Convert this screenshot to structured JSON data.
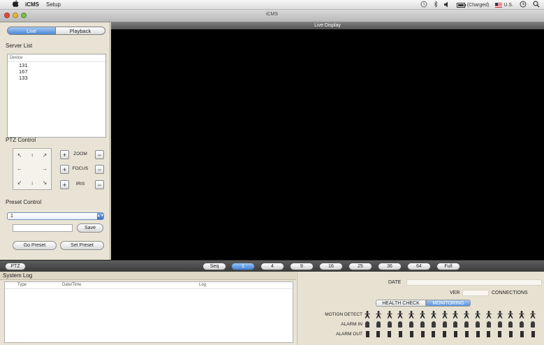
{
  "menubar": {
    "app_name": "iCMS",
    "menus": [
      "Setup"
    ],
    "status_items": {
      "battery_text": "(Charged)",
      "input_source": "U.S."
    }
  },
  "window": {
    "title": "iCMS"
  },
  "mode_tabs": {
    "live": "Live",
    "playback": "Playback",
    "selected": "Live"
  },
  "server_list": {
    "title": "Server List",
    "column": "Device",
    "devices": [
      "131",
      "167",
      "133"
    ]
  },
  "ptz": {
    "title": "PTZ Control",
    "pad_arrows": [
      "↖",
      "↑",
      "↗",
      "←",
      "",
      "→",
      "↙",
      "↓",
      "↘"
    ],
    "zoom_label": "ZOOM",
    "focus_label": "FOCUS",
    "iris_label": "IRIS",
    "plus": "+",
    "minus": "−"
  },
  "preset": {
    "title": "Preset Control",
    "selected": "1",
    "input_value": "",
    "save_label": "Save",
    "go_label": "Go Preset",
    "set_label": "Set Preset"
  },
  "live_display": {
    "title": "Live Display"
  },
  "toolbar": {
    "ptz_label": "PTZ",
    "layout_buttons": [
      "Seq",
      "1",
      "4",
      "9",
      "16",
      "25",
      "36",
      "64",
      "Full"
    ],
    "active_layout": "1"
  },
  "system_log": {
    "title": "System Log",
    "columns": [
      "Type",
      "Date/Time",
      "Log"
    ]
  },
  "status": {
    "date_label": "DATE",
    "ver_label": "VER",
    "connections_label": "CONNECTIONS",
    "tabs": [
      "HEALTH CHECK",
      "MONITORING"
    ],
    "active_tab": "MONITORING",
    "motion_detect": "MOTION DETECT",
    "alarm_in": "ALARM IN",
    "alarm_out": "ALARM OUT"
  }
}
